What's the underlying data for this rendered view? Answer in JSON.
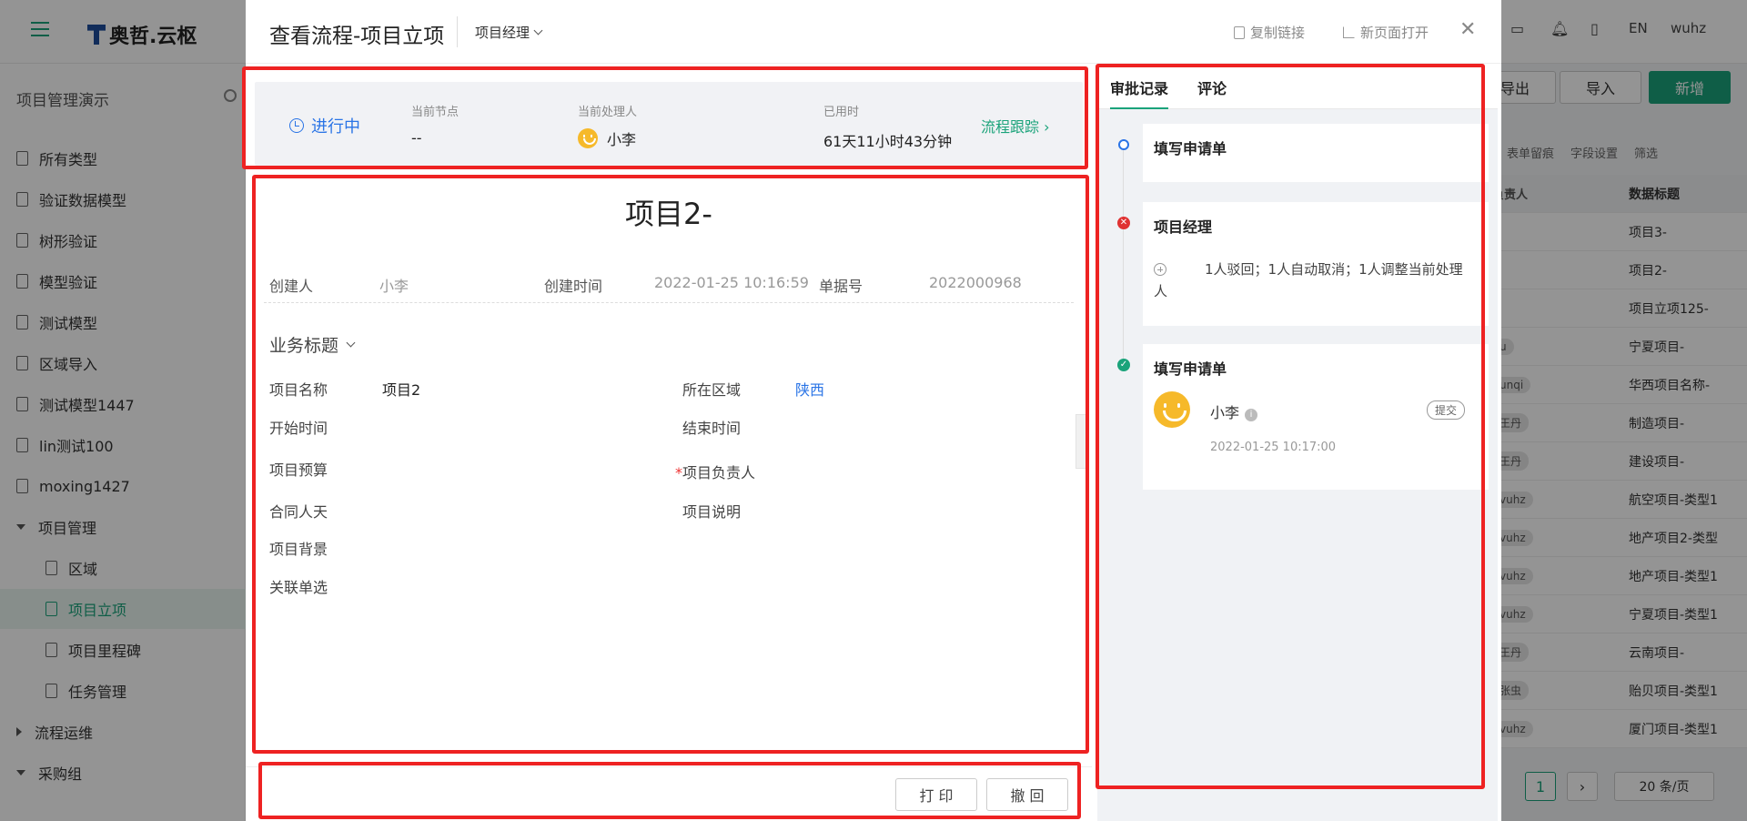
{
  "background": {
    "logo_text": "奥哲.云枢",
    "top_lang": "EN",
    "top_user": "wuhz",
    "sidebar": {
      "title": "项目管理演示",
      "items": [
        {
          "label": "所有类型",
          "level": 0
        },
        {
          "label": "验证数据模型",
          "level": 0
        },
        {
          "label": "树形验证",
          "level": 0
        },
        {
          "label": "模型验证",
          "level": 0
        },
        {
          "label": "测试模型",
          "level": 0
        },
        {
          "label": "区域导入",
          "level": 0
        },
        {
          "label": "测试模型1447",
          "level": 0
        },
        {
          "label": "lin测试100",
          "level": 0
        },
        {
          "label": "moxing1427",
          "level": 0
        },
        {
          "label": "项目管理",
          "level": 0,
          "group": true,
          "open": true
        },
        {
          "label": "区域",
          "level": 1
        },
        {
          "label": "项目立项",
          "level": 1,
          "active": true
        },
        {
          "label": "项目里程碑",
          "level": 1
        },
        {
          "label": "任务管理",
          "level": 1
        },
        {
          "label": "流程运维",
          "level": 0,
          "group": true,
          "open": false
        },
        {
          "label": "采购组",
          "level": 0,
          "group": true,
          "open": true
        }
      ]
    },
    "buttons": {
      "export": "导出",
      "import": "导入",
      "add": "新增"
    },
    "toolbar": {
      "form_trace": "表单留痕",
      "field_settings": "字段设置",
      "filter": "筛选"
    },
    "table": {
      "headers": [
        "负责人",
        "数据标题"
      ],
      "rows": [
        {
          "owner": "",
          "title": "项目3-"
        },
        {
          "owner": "",
          "title": "项目2-"
        },
        {
          "owner": "",
          "title": "项目立项125-"
        },
        {
          "owner": "u",
          "title": "宁夏项目-"
        },
        {
          "owner": "unqi",
          "title": "华西项目名称-"
        },
        {
          "owner": "王丹",
          "title": "制造项目-"
        },
        {
          "owner": "王丹",
          "title": "建设项目-"
        },
        {
          "owner": "vuhz",
          "title": "航空项目-类型1"
        },
        {
          "owner": "vuhz",
          "title": "地产项目2-类型"
        },
        {
          "owner": "vuhz",
          "title": "地产项目-类型1"
        },
        {
          "owner": "vuhz",
          "title": "宁夏项目-类型1"
        },
        {
          "owner": "王丹",
          "title": "云南项目-"
        },
        {
          "owner": "张虫",
          "title": "贻贝项目-类型1"
        },
        {
          "owner": "vuhz",
          "title": "厦门项目-类型1"
        }
      ]
    },
    "pagination": {
      "page": "1",
      "page_size": "20 条/页"
    }
  },
  "drawer": {
    "title": "查看流程-项目立项",
    "role": "项目经理",
    "copy_link": "复制链接",
    "open_new": "新页面打开",
    "status": {
      "state": "进行中",
      "node_label": "当前节点",
      "node_value": "--",
      "handler_label": "当前处理人",
      "handler_value": "小李",
      "elapsed_label": "已用时",
      "elapsed_value": "61天11小时43分钟",
      "track": "流程跟踪"
    },
    "doc": {
      "title": "项目2-",
      "creator_label": "创建人",
      "creator_value": "小李",
      "created_label": "创建时间",
      "created_value": "2022-01-25 10:16:59",
      "docno_label": "单据号",
      "docno_value": "2022000968",
      "section": "业务标题",
      "fields": {
        "name_label": "项目名称",
        "name_value": "项目2",
        "region_label": "所在区域",
        "region_value": "陕西",
        "start_label": "开始时间",
        "end_label": "结束时间",
        "budget_label": "项目预算",
        "owner_label": "项目负责人",
        "contract_label": "合同人天",
        "desc_label": "项目说明",
        "background_label": "项目背景",
        "related_label": "关联单选"
      }
    },
    "footer": {
      "print": "打 印",
      "revoke": "撤 回"
    },
    "right_panel": {
      "tab_records": "审批记录",
      "tab_comments": "评论",
      "timeline": [
        {
          "title": "填写申请单",
          "status": "pending"
        },
        {
          "title": "项目经理",
          "status": "rejected",
          "note": "1人驳回；1人自动取消；1人调整当前处理人"
        },
        {
          "title": "填写申请单",
          "status": "done",
          "user": "小李",
          "tag": "提交",
          "time": "2022-01-25 10:17:00"
        }
      ]
    }
  },
  "colors": {
    "accent": "#1aa37a",
    "link_blue": "#2a74e6",
    "highlight_red": "#ee2222"
  }
}
